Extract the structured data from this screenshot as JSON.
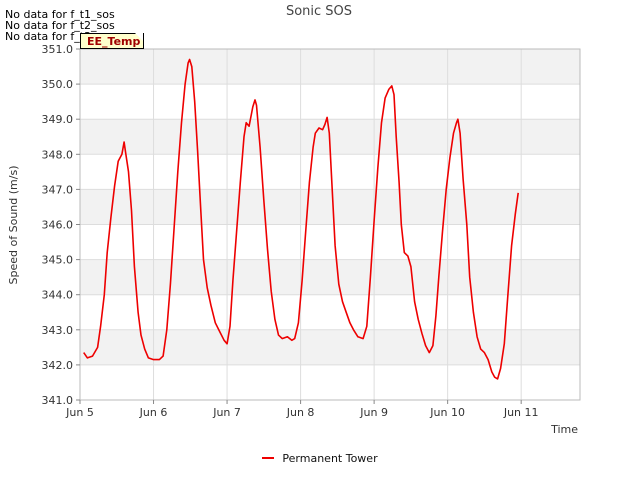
{
  "nodata_messages": [
    "No data for f_t1_sos",
    "No data for f_t2_sos",
    "No data for f_t3_sos"
  ],
  "tag_label": "EE_Temp",
  "colors": {
    "series": "#ee0000",
    "band": "#f2f2f2",
    "grid": "#dddddd",
    "axis": "#bbbbbb"
  },
  "chart_data": {
    "type": "line",
    "title": "Sonic SOS",
    "xlabel": "Time",
    "ylabel": "Speed of Sound (m/s)",
    "ylim": [
      341.0,
      351.0
    ],
    "xlim": [
      0,
      6.8
    ],
    "yticks": [
      "341.0",
      "342.0",
      "343.0",
      "344.0",
      "345.0",
      "346.0",
      "347.0",
      "348.0",
      "349.0",
      "350.0",
      "351.0"
    ],
    "xticks": [
      {
        "label": "Jun 5",
        "x": 0
      },
      {
        "label": "Jun 6",
        "x": 1
      },
      {
        "label": "Jun 7",
        "x": 2
      },
      {
        "label": "Jun 8",
        "x": 3
      },
      {
        "label": "Jun 9",
        "x": 4
      },
      {
        "label": "Jun 10",
        "x": 5
      },
      {
        "label": "Jun 11",
        "x": 6
      }
    ],
    "x_unit": "days since Jun 5 00:00",
    "series": [
      {
        "name": "Permanent Tower",
        "points": [
          [
            0.05,
            342.35
          ],
          [
            0.1,
            342.2
          ],
          [
            0.17,
            342.25
          ],
          [
            0.24,
            342.5
          ],
          [
            0.28,
            343.1
          ],
          [
            0.33,
            344.0
          ],
          [
            0.37,
            345.2
          ],
          [
            0.42,
            346.2
          ],
          [
            0.47,
            347.1
          ],
          [
            0.52,
            347.8
          ],
          [
            0.57,
            348.0
          ],
          [
            0.6,
            348.35
          ],
          [
            0.62,
            348.05
          ],
          [
            0.66,
            347.5
          ],
          [
            0.7,
            346.4
          ],
          [
            0.74,
            344.8
          ],
          [
            0.79,
            343.5
          ],
          [
            0.83,
            342.85
          ],
          [
            0.88,
            342.45
          ],
          [
            0.93,
            342.2
          ],
          [
            1.0,
            342.15
          ],
          [
            1.08,
            342.15
          ],
          [
            1.13,
            342.25
          ],
          [
            1.18,
            343.0
          ],
          [
            1.23,
            344.3
          ],
          [
            1.28,
            345.9
          ],
          [
            1.33,
            347.5
          ],
          [
            1.38,
            348.9
          ],
          [
            1.43,
            350.0
          ],
          [
            1.47,
            350.6
          ],
          [
            1.49,
            350.7
          ],
          [
            1.52,
            350.5
          ],
          [
            1.56,
            349.5
          ],
          [
            1.6,
            348.1
          ],
          [
            1.64,
            346.5
          ],
          [
            1.68,
            345.0
          ],
          [
            1.73,
            344.2
          ],
          [
            1.78,
            343.7
          ],
          [
            1.84,
            343.2
          ],
          [
            1.9,
            342.95
          ],
          [
            1.96,
            342.7
          ],
          [
            2.0,
            342.6
          ],
          [
            2.04,
            343.1
          ],
          [
            2.08,
            344.4
          ],
          [
            2.13,
            345.8
          ],
          [
            2.18,
            347.2
          ],
          [
            2.23,
            348.5
          ],
          [
            2.26,
            348.9
          ],
          [
            2.3,
            348.8
          ],
          [
            2.35,
            349.35
          ],
          [
            2.38,
            349.55
          ],
          [
            2.4,
            349.4
          ],
          [
            2.45,
            348.2
          ],
          [
            2.5,
            346.7
          ],
          [
            2.55,
            345.3
          ],
          [
            2.6,
            344.1
          ],
          [
            2.65,
            343.3
          ],
          [
            2.7,
            342.85
          ],
          [
            2.75,
            342.75
          ],
          [
            2.82,
            342.8
          ],
          [
            2.88,
            342.7
          ],
          [
            2.92,
            342.75
          ],
          [
            2.97,
            343.2
          ],
          [
            3.02,
            344.4
          ],
          [
            3.07,
            345.8
          ],
          [
            3.12,
            347.2
          ],
          [
            3.17,
            348.2
          ],
          [
            3.2,
            348.6
          ],
          [
            3.25,
            348.75
          ],
          [
            3.3,
            348.7
          ],
          [
            3.33,
            348.85
          ],
          [
            3.36,
            349.05
          ],
          [
            3.39,
            348.6
          ],
          [
            3.43,
            347.0
          ],
          [
            3.47,
            345.4
          ],
          [
            3.52,
            344.3
          ],
          [
            3.57,
            343.8
          ],
          [
            3.62,
            343.5
          ],
          [
            3.67,
            343.2
          ],
          [
            3.72,
            343.0
          ],
          [
            3.78,
            342.8
          ],
          [
            3.85,
            342.75
          ],
          [
            3.9,
            343.1
          ],
          [
            3.95,
            344.5
          ],
          [
            4.0,
            346.1
          ],
          [
            4.05,
            347.6
          ],
          [
            4.1,
            348.9
          ],
          [
            4.15,
            349.6
          ],
          [
            4.2,
            349.85
          ],
          [
            4.24,
            349.95
          ],
          [
            4.27,
            349.7
          ],
          [
            4.3,
            348.5
          ],
          [
            4.34,
            347.2
          ],
          [
            4.37,
            346.0
          ],
          [
            4.41,
            345.2
          ],
          [
            4.46,
            345.1
          ],
          [
            4.5,
            344.8
          ],
          [
            4.55,
            343.8
          ],
          [
            4.6,
            343.3
          ],
          [
            4.65,
            342.9
          ],
          [
            4.7,
            342.55
          ],
          [
            4.75,
            342.35
          ],
          [
            4.8,
            342.55
          ],
          [
            4.84,
            343.4
          ],
          [
            4.88,
            344.5
          ],
          [
            4.93,
            345.8
          ],
          [
            4.98,
            347.0
          ],
          [
            5.03,
            347.9
          ],
          [
            5.08,
            348.6
          ],
          [
            5.12,
            348.9
          ],
          [
            5.14,
            349.0
          ],
          [
            5.17,
            348.6
          ],
          [
            5.21,
            347.3
          ],
          [
            5.26,
            346.0
          ],
          [
            5.3,
            344.5
          ],
          [
            5.35,
            343.5
          ],
          [
            5.4,
            342.8
          ],
          [
            5.45,
            342.45
          ],
          [
            5.5,
            342.35
          ],
          [
            5.55,
            342.15
          ],
          [
            5.6,
            341.8
          ],
          [
            5.64,
            341.65
          ],
          [
            5.68,
            341.6
          ],
          [
            5.72,
            341.9
          ],
          [
            5.77,
            342.6
          ],
          [
            5.82,
            344.0
          ],
          [
            5.87,
            345.4
          ],
          [
            5.92,
            346.3
          ],
          [
            5.96,
            346.9
          ]
        ]
      }
    ],
    "legend_position": "bottom-center",
    "grid": true
  }
}
